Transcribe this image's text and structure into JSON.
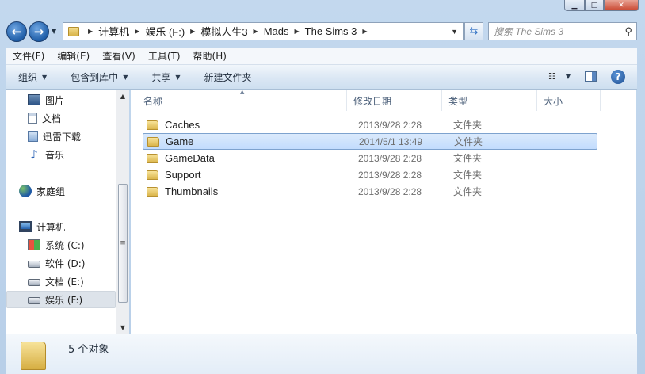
{
  "window": {
    "caption_buttons": {
      "minimize": "▁",
      "maximize": "□",
      "close": "✕"
    }
  },
  "address": {
    "breadcrumbs": [
      "计算机",
      "娱乐 (F:)",
      "模拟人生3",
      "Mads",
      "The Sims 3"
    ],
    "search_placeholder": "搜索 The Sims 3"
  },
  "menu": {
    "items": [
      "文件(F)",
      "编辑(E)",
      "查看(V)",
      "工具(T)",
      "帮助(H)"
    ]
  },
  "toolbar": {
    "organize": "组织",
    "include_in_library": "包含到库中",
    "share": "共享",
    "new_folder": "新建文件夹"
  },
  "nav": {
    "items": [
      {
        "label": "图片",
        "icon": "pictures-icon"
      },
      {
        "label": "文档",
        "icon": "documents-icon"
      },
      {
        "label": "迅雷下载",
        "icon": "download-folder-icon"
      },
      {
        "label": "音乐",
        "icon": "music-icon"
      },
      {
        "label": "家庭组",
        "icon": "homegroup-icon"
      },
      {
        "label": "计算机",
        "icon": "computer-icon"
      },
      {
        "label": "系统 (C:)",
        "icon": "system-drive-icon"
      },
      {
        "label": "软件 (D:)",
        "icon": "drive-icon"
      },
      {
        "label": "文档 (E:)",
        "icon": "drive-icon"
      },
      {
        "label": "娱乐 (F:)",
        "icon": "drive-icon",
        "selected": true
      }
    ]
  },
  "columns": {
    "name": "名称",
    "date": "修改日期",
    "type": "类型",
    "size": "大小"
  },
  "files": [
    {
      "name": "Caches",
      "date": "2013/9/28 2:28",
      "type": "文件夹"
    },
    {
      "name": "Game",
      "date": "2014/5/1 13:49",
      "type": "文件夹",
      "selected": true
    },
    {
      "name": "GameData",
      "date": "2013/9/28 2:28",
      "type": "文件夹"
    },
    {
      "name": "Support",
      "date": "2013/9/28 2:28",
      "type": "文件夹"
    },
    {
      "name": "Thumbnails",
      "date": "2013/9/28 2:28",
      "type": "文件夹"
    }
  ],
  "details": {
    "count": "5 个对象"
  }
}
